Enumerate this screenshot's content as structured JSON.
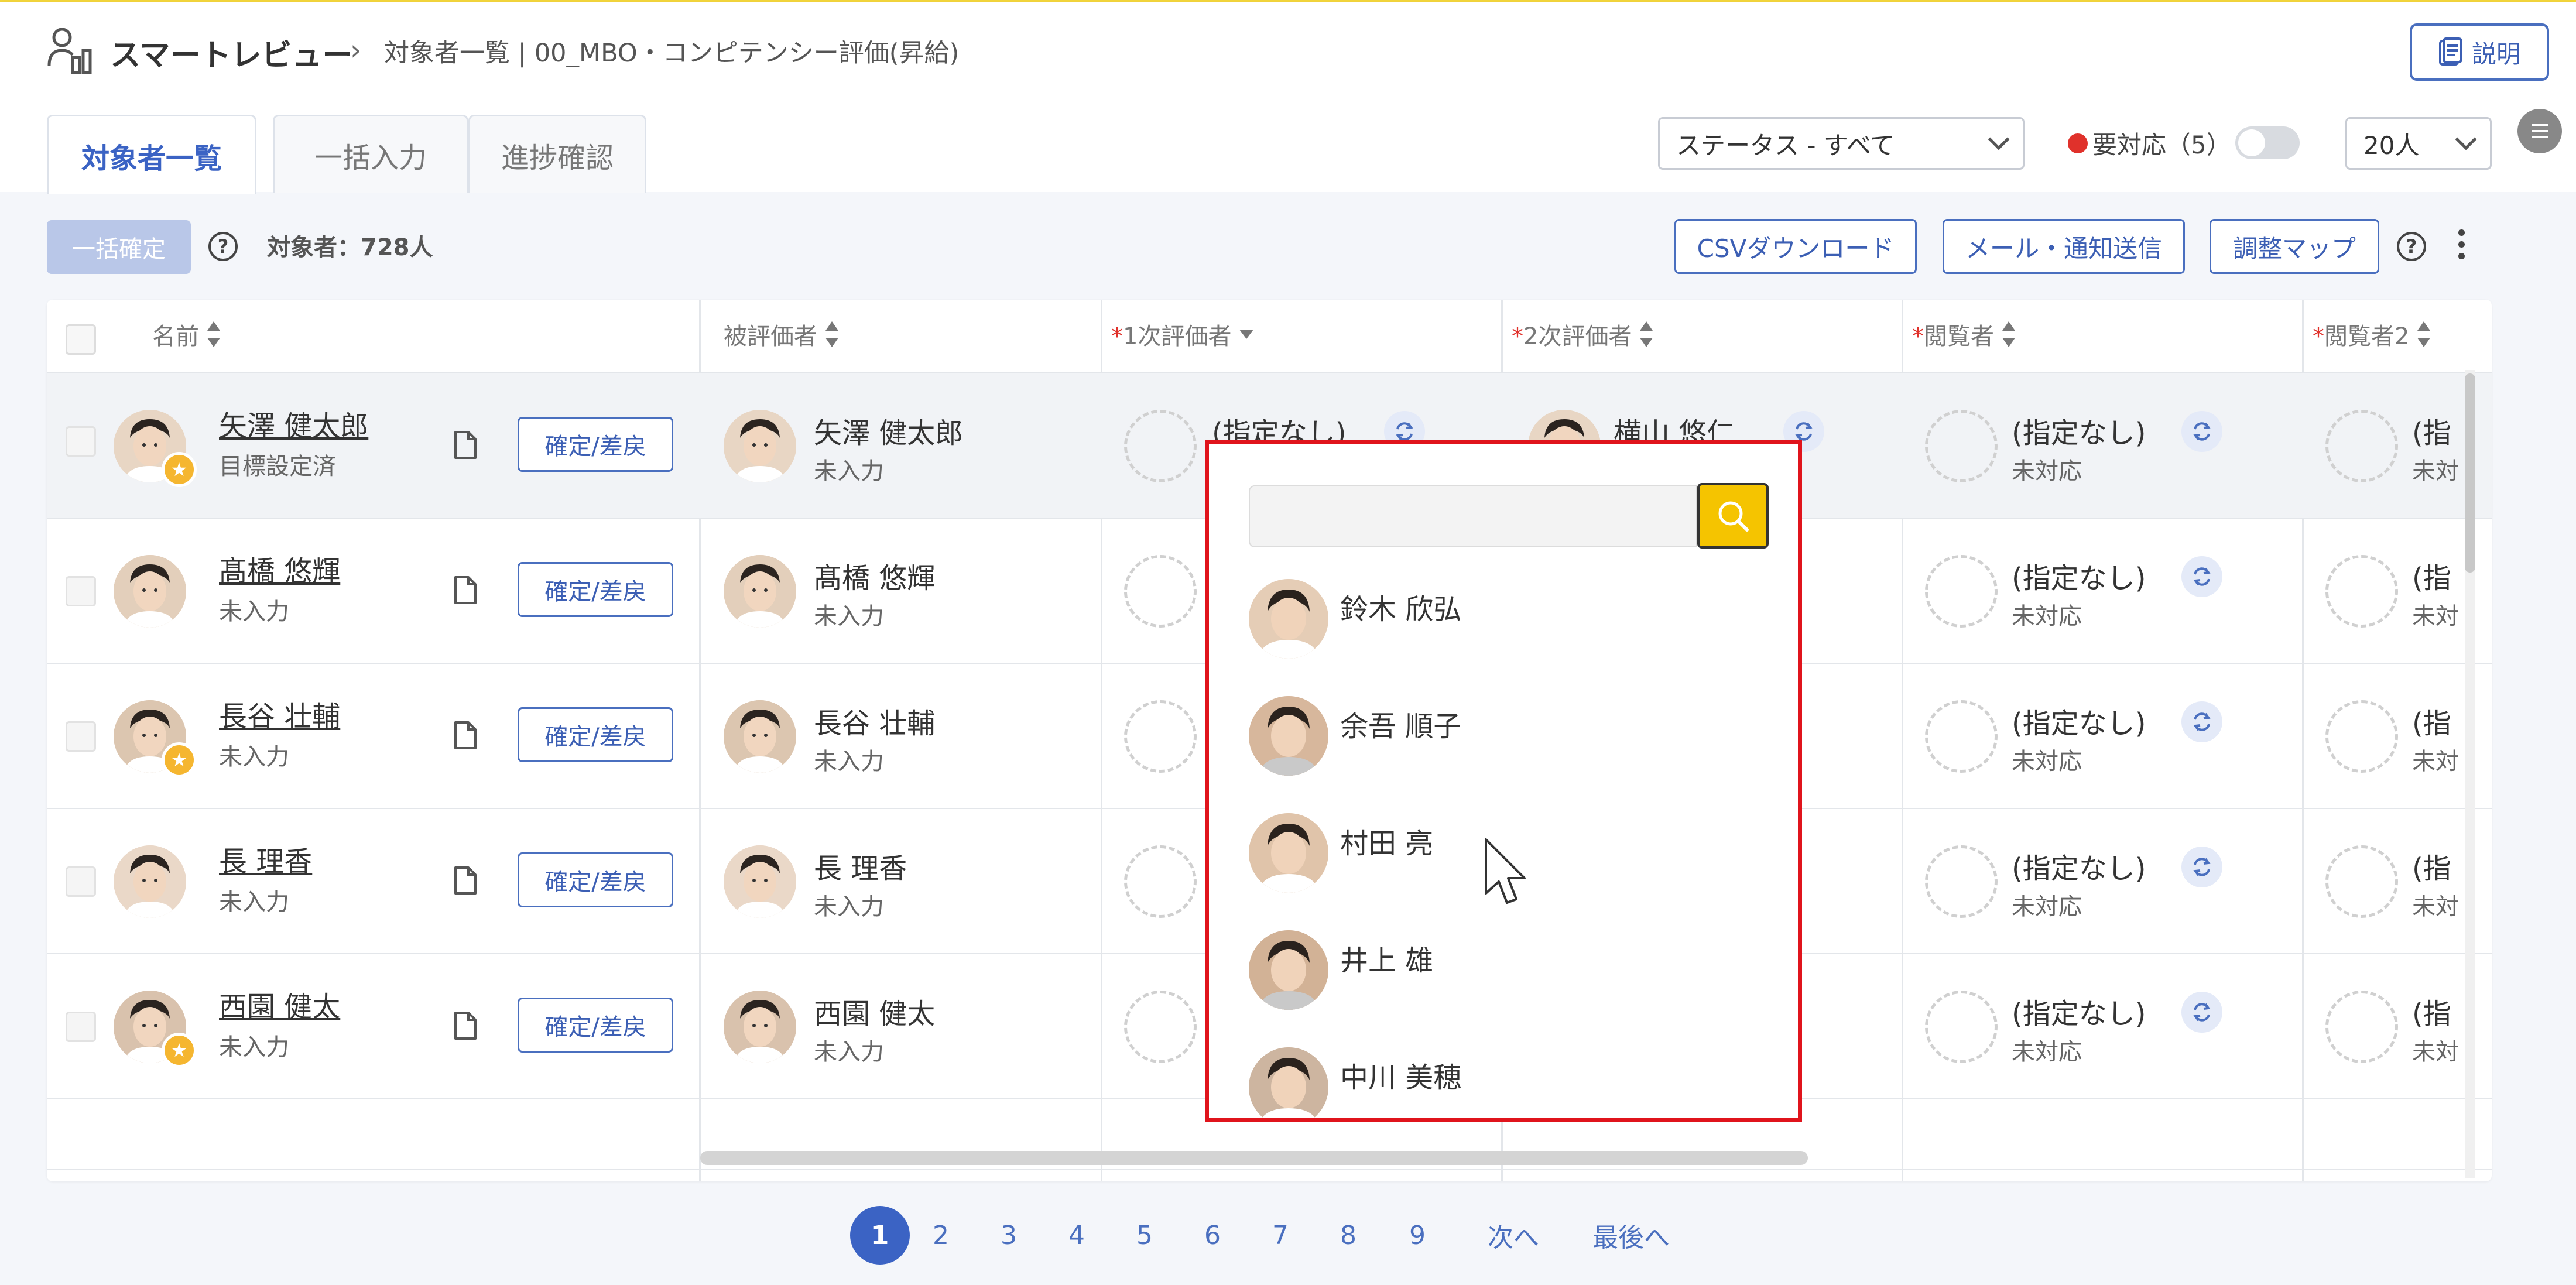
{
  "header": {
    "app_name": "スマートレビュー",
    "breadcrumb": "対象者一覧 | 00_MBO・コンピテンシー評価(昇給)",
    "help_label": "説明"
  },
  "tabs": [
    {
      "label": "対象者一覧",
      "active": true
    },
    {
      "label": "一括入力",
      "active": false
    },
    {
      "label": "進捗確認",
      "active": false
    }
  ],
  "filters": {
    "status_select": "ステータス - すべて",
    "needs_action_label": "要対応（5）",
    "needs_action_dot_color": "#e0312b",
    "needs_action_toggle_on": false,
    "per_page_select": "20人"
  },
  "toolbar": {
    "confirm_all_label": "一括確定",
    "target_count_label": "対象者：728人",
    "csv_label": "CSVダウンロード",
    "mail_label": "メール・通知送信",
    "map_label": "調整マップ"
  },
  "table": {
    "columns": [
      "名前",
      "被評価者",
      "1次評価者",
      "2次評価者",
      "閲覧者",
      "閲覧者2"
    ],
    "required_columns": [
      "1次評価者",
      "2次評価者",
      "閲覧者",
      "閲覧者2"
    ],
    "action_label": "確定/差戻",
    "unset_label": "(指定なし)",
    "unset_short": "(指",
    "pending_label": "未対応",
    "pending_short": "未対",
    "rows": [
      {
        "name": "矢澤 健太郎",
        "status": "目標設定済",
        "reviewee_status": "未入力",
        "star": true,
        "second_reviewer": "横山 悠仁"
      },
      {
        "name": "髙橋 悠輝",
        "status": "未入力",
        "reviewee_status": "未入力",
        "star": false
      },
      {
        "name": "長谷 壮輔",
        "status": "未入力",
        "reviewee_status": "未入力",
        "star": true
      },
      {
        "name": "長 理香",
        "status": "未入力",
        "reviewee_status": "未入力",
        "star": false
      },
      {
        "name": "西園 健太",
        "status": "未入力",
        "reviewee_status": "未入力",
        "star": true
      }
    ]
  },
  "dropdown": {
    "search_placeholder": "",
    "options": [
      "鈴木 欣弘",
      "余吾 順子",
      "村田 亮",
      "井上 雄",
      "中川 美穂"
    ]
  },
  "pagination": {
    "pages": [
      "1",
      "2",
      "3",
      "4",
      "5",
      "6",
      "7",
      "8",
      "9"
    ],
    "current": "1",
    "next_label": "次へ",
    "last_label": "最後へ"
  },
  "colors": {
    "accent": "#3b63c4",
    "highlight": "#e0141c",
    "search_button": "#f5c400",
    "star": "#f5b630"
  }
}
